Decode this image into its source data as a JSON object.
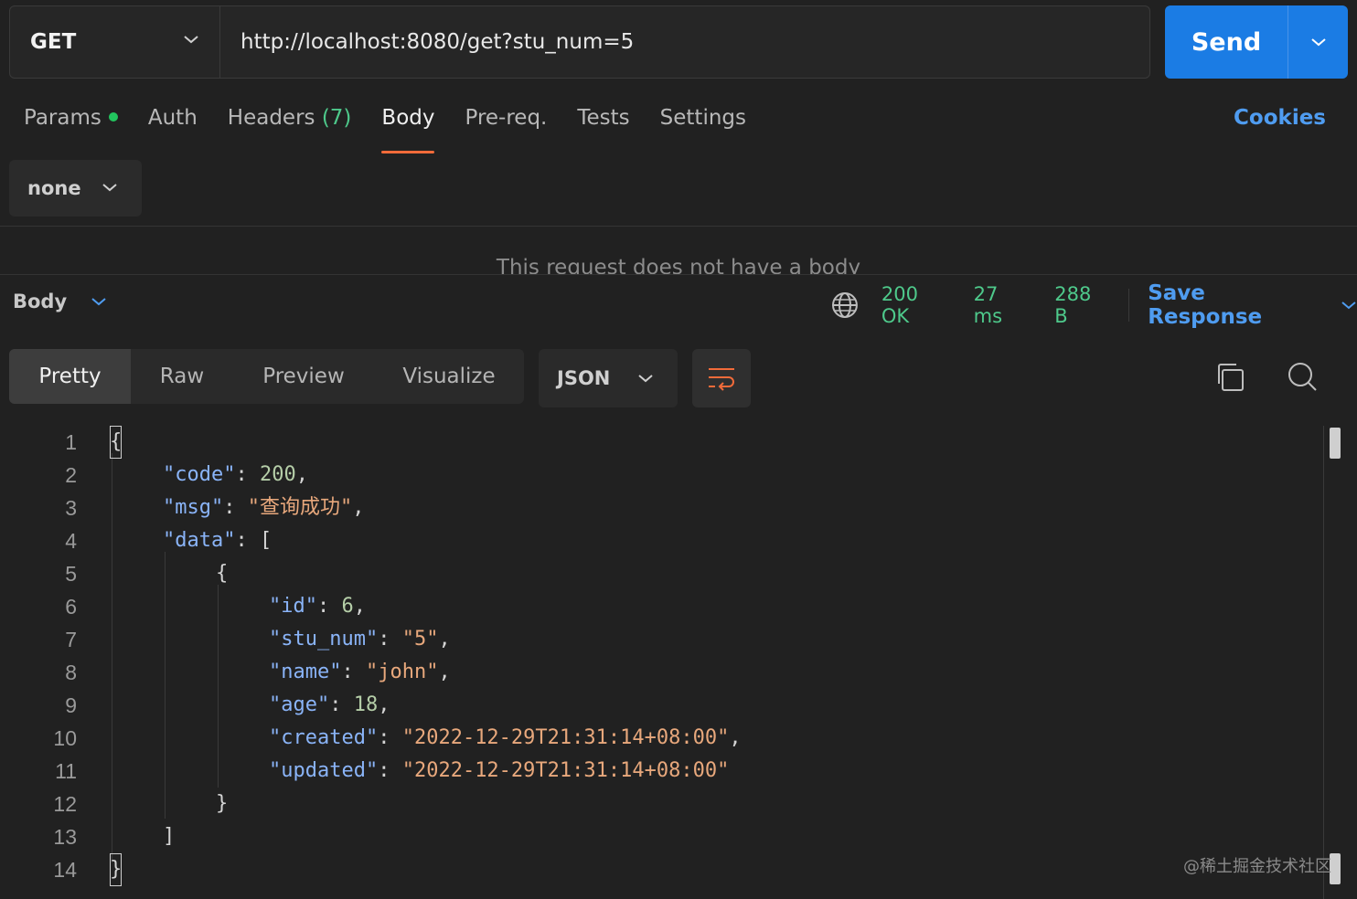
{
  "request": {
    "method": "GET",
    "url": "http://localhost:8080/get?stu_num=5",
    "send_label": "Send"
  },
  "request_tabs": {
    "params": "Params",
    "auth": "Auth",
    "headers": "Headers",
    "headers_count": "(7)",
    "body": "Body",
    "prereq": "Pre-req.",
    "tests": "Tests",
    "settings": "Settings",
    "cookies": "Cookies"
  },
  "body_type": "none",
  "no_body_message": "This request does not have a body",
  "response": {
    "section_label": "Body",
    "status": "200 OK",
    "time": "27 ms",
    "size": "288 B",
    "save_label": "Save Response",
    "view_tabs": [
      "Pretty",
      "Raw",
      "Preview",
      "Visualize"
    ],
    "format": "JSON"
  },
  "code_lines": [
    "1",
    "2",
    "3",
    "4",
    "5",
    "6",
    "7",
    "8",
    "9",
    "10",
    "11",
    "12",
    "13",
    "14"
  ],
  "json": {
    "code_key": "\"code\"",
    "code_val": "200",
    "msg_key": "\"msg\"",
    "msg_val": "\"查询成功\"",
    "data_key": "\"data\"",
    "id_key": "\"id\"",
    "id_val": "6",
    "stu_num_key": "\"stu_num\"",
    "stu_num_val": "\"5\"",
    "name_key": "\"name\"",
    "name_val": "\"john\"",
    "age_key": "\"age\"",
    "age_val": "18",
    "created_key": "\"created\"",
    "created_val": "\"2022-12-29T21:31:14+08:00\"",
    "updated_key": "\"updated\"",
    "updated_val": "\"2022-12-29T21:31:14+08:00\""
  },
  "watermark": "@稀土掘金技术社区",
  "icons": {
    "globe": "globe-icon",
    "wrap": "wrap-lines-icon",
    "copy": "copy-icon",
    "search": "search-icon",
    "chevron": "chevron-down-icon"
  },
  "colors": {
    "send": "#1b7ce4",
    "active_tab_underline": "#f26b3a",
    "status": "#4ec98b",
    "link": "#4f9cf0"
  }
}
